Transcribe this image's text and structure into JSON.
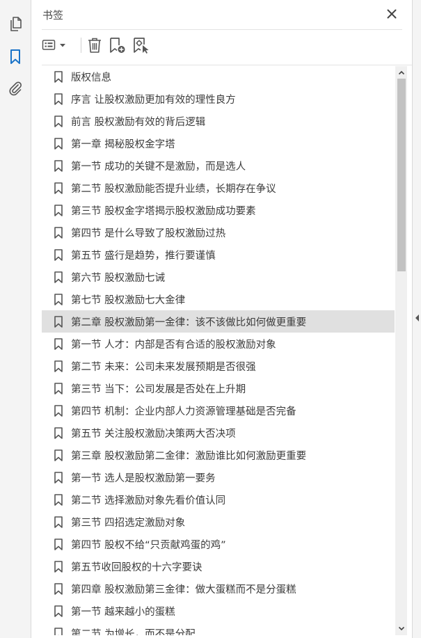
{
  "panel": {
    "title": "书签"
  },
  "colors": {
    "rail_active": "#1a73c8",
    "icon_gray": "#555555",
    "selected_row": "#e0e0e0"
  },
  "rail": {
    "icons": [
      "pages-icon",
      "bookmark-icon",
      "attachment-icon"
    ],
    "active": "bookmark-icon"
  },
  "toolbar": {
    "icons": [
      "options-menu-icon",
      "delete-icon",
      "new-bookmark-icon",
      "bookmark-from-structure-icon"
    ]
  },
  "bookmarks": [
    {
      "label": "版权信息"
    },
    {
      "label": "序言 让股权激励更加有效的理性良方"
    },
    {
      "label": "前言 股权激励有效的背后逻辑"
    },
    {
      "label": "第一章 揭秘股权金字塔"
    },
    {
      "label": "第一节 成功的关键不是激励，而是选人"
    },
    {
      "label": "第二节 股权激励能否提升业绩，长期存在争议"
    },
    {
      "label": "第三节 股权金字塔揭示股权激励成功要素"
    },
    {
      "label": "第四节 是什么导致了股权激励过热"
    },
    {
      "label": "第五节 盛行是趋势，推行要谨慎"
    },
    {
      "label": "第六节 股权激励七诫"
    },
    {
      "label": "第七节 股权激励七大金律"
    },
    {
      "label": "第二章 股权激励第一金律：该不该做比如何做更重要",
      "selected": true
    },
    {
      "label": "第一节 人才：内部是否有合适的股权激励对象"
    },
    {
      "label": "第二节 未来：公司未来发展预期是否很强"
    },
    {
      "label": "第三节 当下：公司发展是否处在上升期"
    },
    {
      "label": "第四节 机制：企业内部人力资源管理基础是否完备"
    },
    {
      "label": "第五节 关注股权激励决策两大否决项"
    },
    {
      "label": "第三章 股权激励第二金律：激励谁比如何激励更重要"
    },
    {
      "label": "第一节 选人是股权激励第一要务"
    },
    {
      "label": "第二节 选择激励对象先看价值认同"
    },
    {
      "label": "第三节 四招选定激励对象"
    },
    {
      "label": "第四节 股权不给“只贡献鸡蛋的鸡”"
    },
    {
      "label": "第五节收回股权的十六字要诀"
    },
    {
      "label": "第四章 股权激励第三金律：做大蛋糕而不是分蛋糕"
    },
    {
      "label": "第一节 越来越小的蛋糕"
    },
    {
      "label": "第二节 为增长，而不是分配"
    }
  ]
}
